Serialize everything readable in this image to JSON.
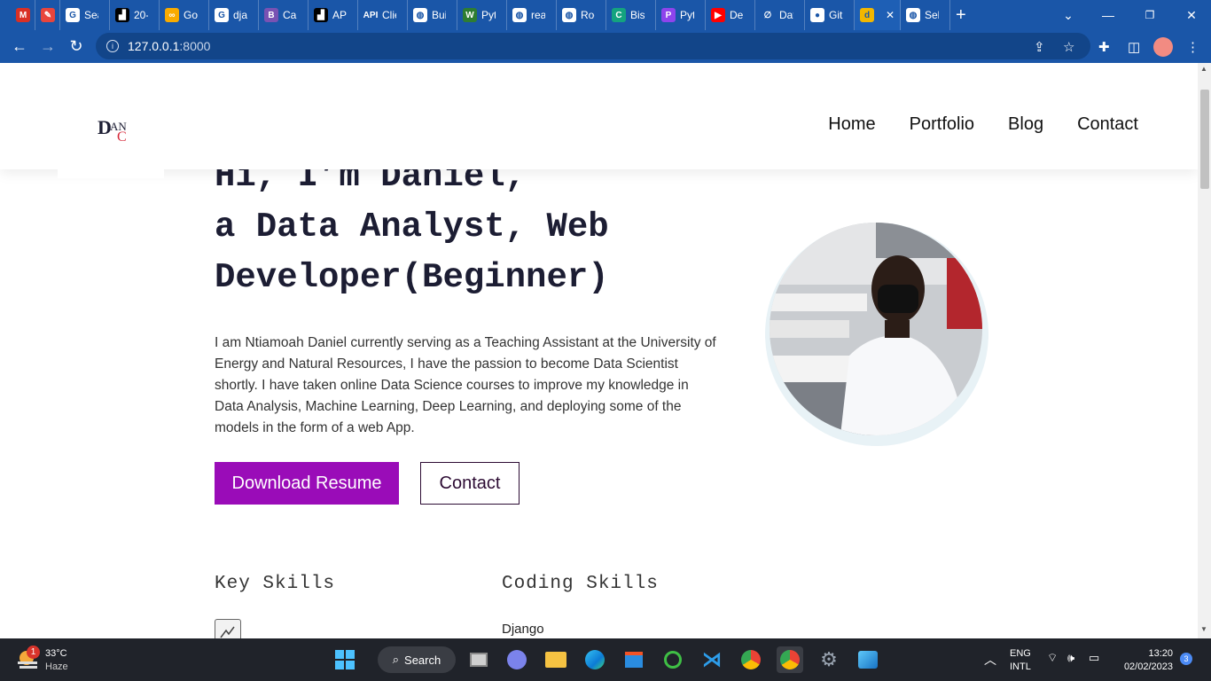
{
  "browser": {
    "tabs": [
      {
        "title": "",
        "icon": "gmail-icon",
        "color": "#d93025",
        "glyph": "M"
      },
      {
        "title": "",
        "icon": "eraser-icon",
        "color": "#e8453c",
        "glyph": "✎"
      },
      {
        "title": "Sea",
        "icon": "google-icon",
        "color": "#ffffff",
        "glyph": "G"
      },
      {
        "title": "20-",
        "icon": "devto-icon",
        "color": "#000000",
        "glyph": "▟"
      },
      {
        "title": "Go",
        "icon": "colab-icon",
        "color": "#f9ab00",
        "glyph": "∞"
      },
      {
        "title": "dja",
        "icon": "google-icon",
        "color": "#ffffff",
        "glyph": "G"
      },
      {
        "title": "Car",
        "icon": "bootstrap-icon",
        "color": "#7952b3",
        "glyph": "B"
      },
      {
        "title": "API",
        "icon": "devto-icon",
        "color": "#000000",
        "glyph": "▟"
      },
      {
        "title": "Clie",
        "icon": "api-icon",
        "color": "#1a56a8",
        "glyph": "API"
      },
      {
        "title": "Bui",
        "icon": "globe-icon",
        "color": "#ffffff",
        "glyph": "◍"
      },
      {
        "title": "Pyt",
        "icon": "w-icon",
        "color": "#2e7d32",
        "glyph": "W"
      },
      {
        "title": "rea",
        "icon": "globe-icon",
        "color": "#ffffff",
        "glyph": "◍"
      },
      {
        "title": "Roc",
        "icon": "globe-icon",
        "color": "#ffffff",
        "glyph": "◍"
      },
      {
        "title": "Bis",
        "icon": "c-icon",
        "color": "#14a37f",
        "glyph": "C"
      },
      {
        "title": "Pyt",
        "icon": "p-icon",
        "color": "#8e44ec",
        "glyph": "P"
      },
      {
        "title": "Dep",
        "icon": "youtube-icon",
        "color": "#ff0000",
        "glyph": "▶"
      },
      {
        "title": "Dat",
        "icon": "hash-icon",
        "color": "#1a56a8",
        "glyph": "∅"
      },
      {
        "title": "Git",
        "icon": "github-icon",
        "color": "#ffffff",
        "glyph": "●"
      },
      {
        "title": "",
        "icon": "django-tab-icon",
        "color": "#f2b700",
        "glyph": "d",
        "active": true
      },
      {
        "title": "Sel",
        "icon": "globe-icon",
        "color": "#ffffff",
        "glyph": "◍"
      }
    ],
    "new_tab": "+",
    "url_host": "127.0.0.1",
    "url_port": ":8000"
  },
  "site": {
    "nav": {
      "home": "Home",
      "portfolio": "Portfolio",
      "blog": "Blog",
      "contact": "Contact"
    },
    "hero": {
      "line1": "Hi, I’m Daniel,",
      "line2": "a Data Analyst, Web",
      "line3": "Developer(Beginner)",
      "bio": "I am Ntiamoah Daniel currently serving as a Teaching Assistant at the University of Energy and Natural Resources, I have the passion to become Data Scientist shortly. I have taken online Data Science courses to improve my knowledge in Data Analysis, Machine Learning, Deep Learning, and deploying some of the models in the form of a web App."
    },
    "buttons": {
      "download": "Download Resume",
      "contact": "Contact"
    },
    "skills": {
      "key": "Key Skills",
      "coding": "Coding Skills",
      "first_coding": "Django"
    },
    "colors": {
      "accent": "#9a0cb8",
      "heading": "#1c1d33"
    }
  },
  "taskbar": {
    "weather_temp": "33°C",
    "weather_desc": "Haze",
    "weather_badge": "1",
    "search": "Search",
    "lang1": "ENG",
    "lang2": "INTL",
    "time": "13:20",
    "date": "02/02/2023",
    "notif_count": "3"
  }
}
